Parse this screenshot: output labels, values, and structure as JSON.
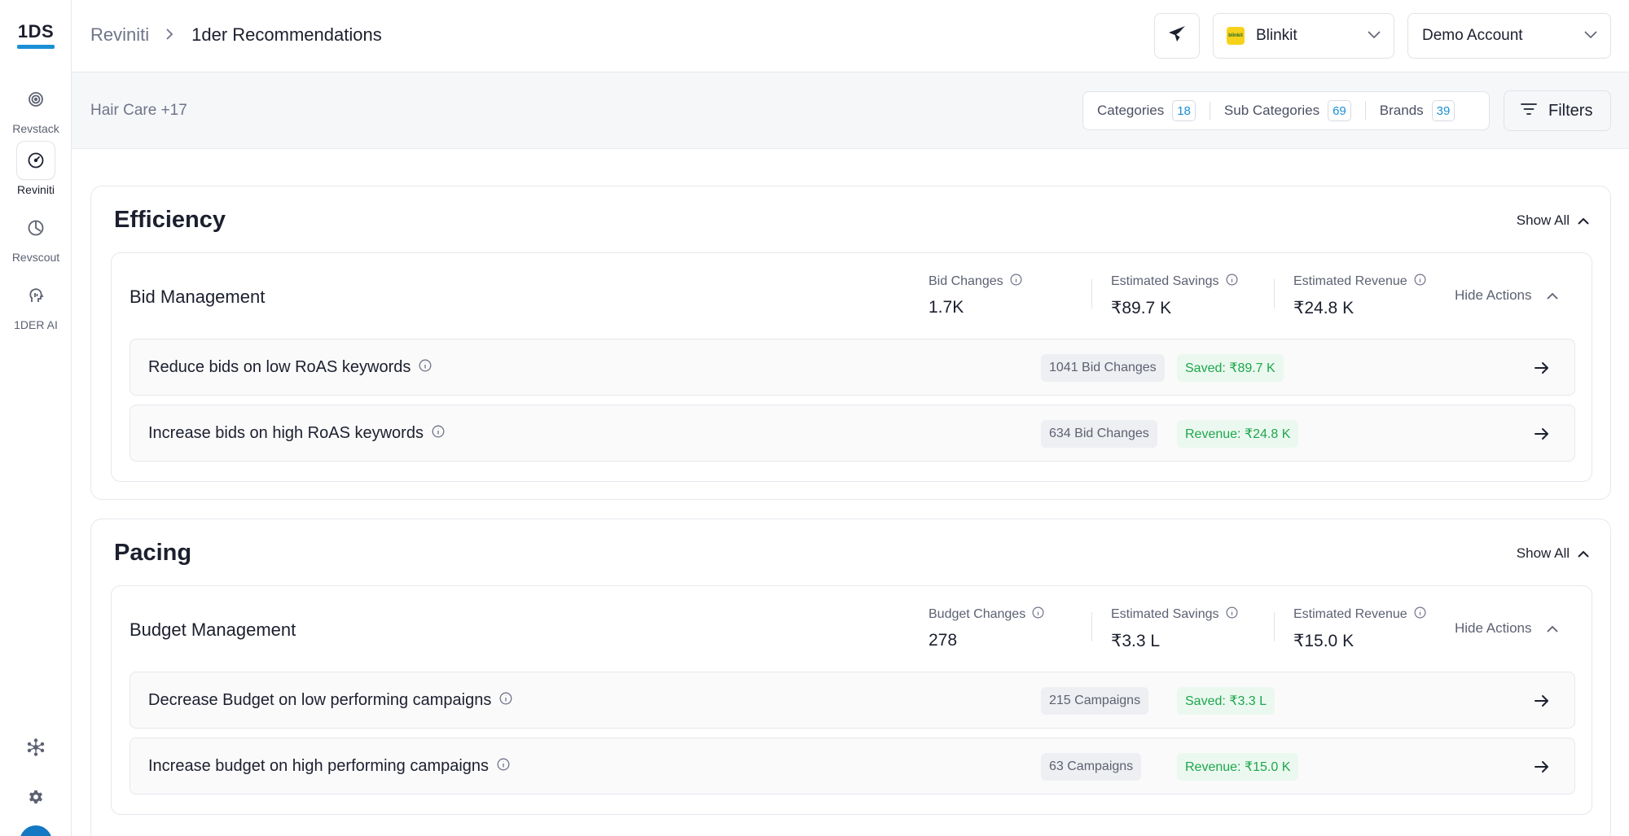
{
  "sidebar": {
    "logo": "1DS",
    "items": [
      {
        "label": "Revstack",
        "icon": "target-icon"
      },
      {
        "label": "Reviniti",
        "icon": "gauge-icon"
      },
      {
        "label": "Revscout",
        "icon": "pie-clock-icon"
      },
      {
        "label": "1DER AI",
        "icon": "ai-head-icon"
      }
    ],
    "bottom_icons": [
      "network-icon",
      "gear-icon"
    ]
  },
  "header": {
    "breadcrumb_root": "Reviniti",
    "breadcrumb_current": "1der Recommendations",
    "platform": "Blinkit",
    "platform_logo_text": "blinkit",
    "account": "Demo Account"
  },
  "filterbar": {
    "category_summary": "Hair Care +17",
    "categories_label": "Categories",
    "categories_count": "18",
    "subcategories_label": "Sub Categories",
    "subcategories_count": "69",
    "brands_label": "Brands",
    "brands_count": "39",
    "filters_label": "Filters"
  },
  "sections": [
    {
      "title": "Efficiency",
      "show_all": "Show All",
      "card": {
        "title": "Bid Management",
        "metrics": [
          {
            "label": "Bid Changes",
            "value": "1.7K"
          },
          {
            "label": "Estimated Savings",
            "value": "₹89.7 K"
          },
          {
            "label": "Estimated Revenue",
            "value": "₹24.8 K"
          }
        ],
        "hide_actions": "Hide Actions",
        "actions": [
          {
            "label": "Reduce bids on low RoAS keywords",
            "count": "1041 Bid Changes",
            "impact": "Saved: ₹89.7 K"
          },
          {
            "label": "Increase bids on high RoAS keywords",
            "count": "634 Bid Changes",
            "impact": "Revenue: ₹24.8 K"
          }
        ]
      }
    },
    {
      "title": "Pacing",
      "show_all": "Show All",
      "card": {
        "title": "Budget Management",
        "metrics": [
          {
            "label": "Budget Changes",
            "value": "278"
          },
          {
            "label": "Estimated Savings",
            "value": "₹3.3 L"
          },
          {
            "label": "Estimated Revenue",
            "value": "₹15.0 K"
          }
        ],
        "hide_actions": "Hide Actions",
        "actions": [
          {
            "label": "Decrease Budget on low performing campaigns",
            "count": "215 Campaigns",
            "impact": "Saved: ₹3.3 L"
          },
          {
            "label": "Increase budget on high performing campaigns",
            "count": "63 Campaigns",
            "impact": "Revenue: ₹15.0 K"
          }
        ]
      }
    }
  ]
}
